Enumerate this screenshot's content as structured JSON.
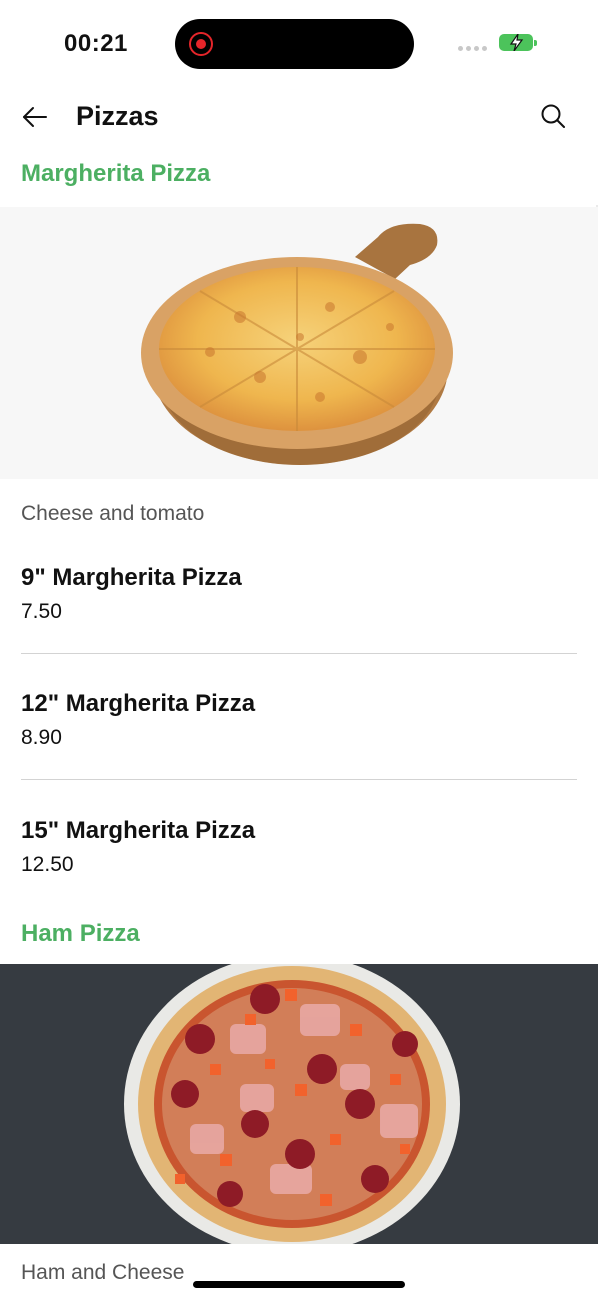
{
  "status": {
    "time": "00:21"
  },
  "header": {
    "title": "Pizzas"
  },
  "categories": [
    {
      "title": "Margherita Pizza",
      "description": "Cheese and tomato",
      "items": [
        {
          "name": "9\" Margherita Pizza",
          "price": "7.50"
        },
        {
          "name": "12\" Margherita Pizza",
          "price": "8.90"
        },
        {
          "name": "15\" Margherita Pizza",
          "price": "12.50"
        }
      ]
    },
    {
      "title": "Ham Pizza",
      "description": "Ham and Cheese"
    }
  ],
  "colors": {
    "accent": "#4caf62",
    "text": "#111111",
    "muted": "#555555",
    "divider": "#d3d3d3"
  },
  "icons": {
    "back": "arrow-left-icon",
    "search": "search-icon"
  }
}
